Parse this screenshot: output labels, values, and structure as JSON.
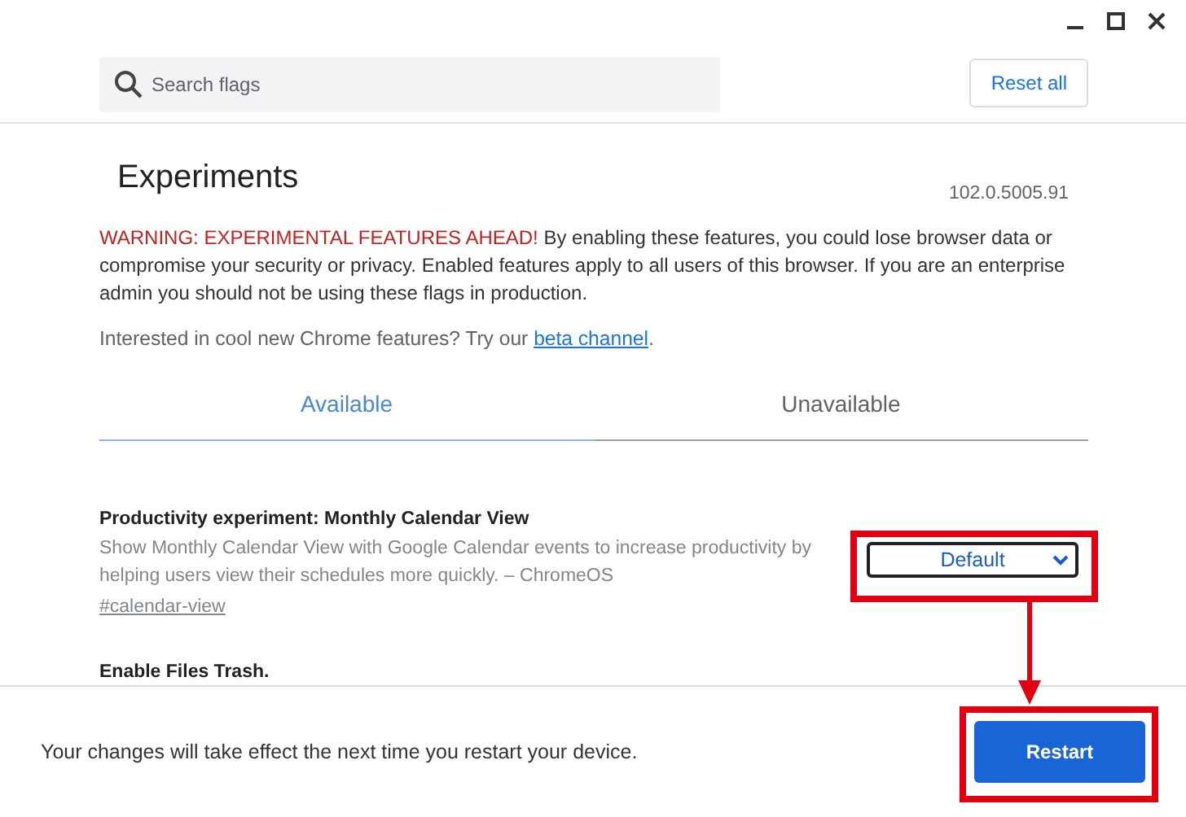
{
  "window_controls": [
    {
      "kind": "minimize"
    },
    {
      "kind": "maximize"
    },
    {
      "kind": "close"
    }
  ],
  "search": {
    "placeholder": "Search flags"
  },
  "reset_button": "Reset all",
  "title": "Experiments",
  "version": "102.0.5005.91",
  "warning": {
    "headline": "WARNING: EXPERIMENTAL FEATURES AHEAD!",
    "text": "By enabling these features, you could lose browser data or compromise your security or privacy. Enabled features apply to all users of this browser. If you are an enterprise admin you should not be using these flags in production."
  },
  "promo": {
    "text": "Interested in cool new Chrome features? Try our",
    "link": "beta channel",
    "end": "."
  },
  "tabs": [
    {
      "label": "Available",
      "selected": true
    },
    {
      "label": "Unavailable",
      "selected": false
    }
  ],
  "flags": [
    {
      "title": "Productivity experiment: Monthly Calendar View",
      "description": "Show Monthly Calendar View with Google Calendar events to increase productivity by helping users view their schedules more quickly. – ChromeOS",
      "anchor": "#calendar-view",
      "value": "Default"
    },
    {
      "title": "Enable Files Trash."
    }
  ],
  "footer": {
    "message": "Your changes will take effect the next time you restart your device.",
    "button": "Restart"
  }
}
